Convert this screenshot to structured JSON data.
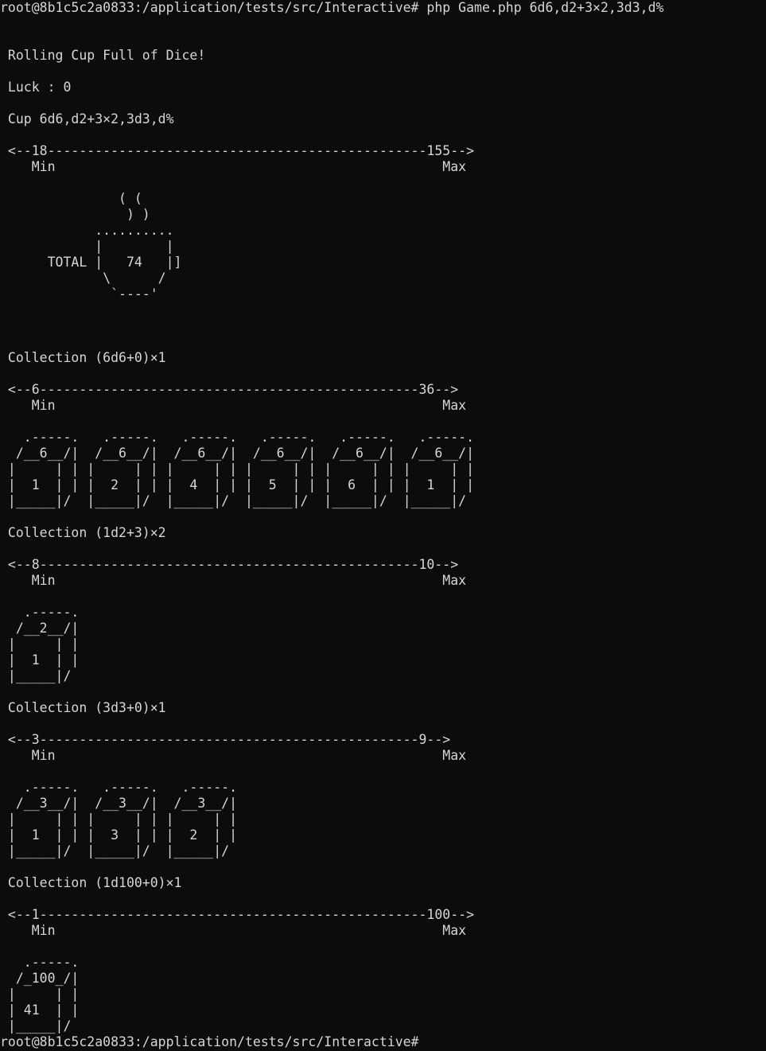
{
  "terminal": {
    "prompt": "root@8b1c5c2a0833:/application/tests/src/Interactive#",
    "command": " php Game.php 6d6,d2+3×2,3d3,d%",
    "final_prompt": "root@8b1c5c2a0833:/application/tests/src/Interactive#",
    "output": [
      "",
      "",
      " Rolling Cup Full of Dice!",
      "",
      " Luck : 0",
      "",
      " Cup 6d6,d2+3×2,3d3,d%",
      "",
      " <--18------------------------------------------------155-->",
      "    Min                                                 Max",
      "",
      "               ( (",
      "                ) )",
      "            ..........",
      "            |        |",
      "      TOTAL |   74   |]",
      "             \\      /",
      "              `----'",
      "",
      "",
      "",
      " Collection (6d6+0)×1",
      "",
      " <--6------------------------------------------------36-->",
      "    Min                                                 Max",
      "",
      "   .-----.   .-----.   .-----.   .-----.   .-----.   .-----.",
      "  /__6__/|  /__6__/|  /__6__/|  /__6__/|  /__6__/|  /__6__/|",
      " |     | | |     | | |     | | |     | | |     | | |     | |",
      " |  1  | | |  2  | | |  4  | | |  5  | | |  6  | | |  1  | |",
      " |_____|/  |_____|/  |_____|/  |_____|/  |_____|/  |_____|/",
      "",
      " Collection (1d2+3)×2",
      "",
      " <--8------------------------------------------------10-->",
      "    Min                                                 Max",
      "",
      "   .-----.",
      "  /__2__/|",
      " |     | |",
      " |  1  | |",
      " |_____|/",
      "",
      " Collection (3d3+0)×1",
      "",
      " <--3------------------------------------------------9-->",
      "    Min                                                 Max",
      "",
      "   .-----.   .-----.   .-----.",
      "  /__3__/|  /__3__/|  /__3__/|",
      " |     | | |     | | |     | |",
      " |  1  | | |  3  | | |  2  | |",
      " |_____|/  |_____|/  |_____|/",
      "",
      " Collection (1d100+0)×1",
      "",
      " <--1-------------------------------------------------100-->",
      "    Min                                                 Max",
      "",
      "   .-----.",
      "  /_100_/|",
      " |     | |",
      " | 41  | |",
      " |_____|/"
    ]
  }
}
